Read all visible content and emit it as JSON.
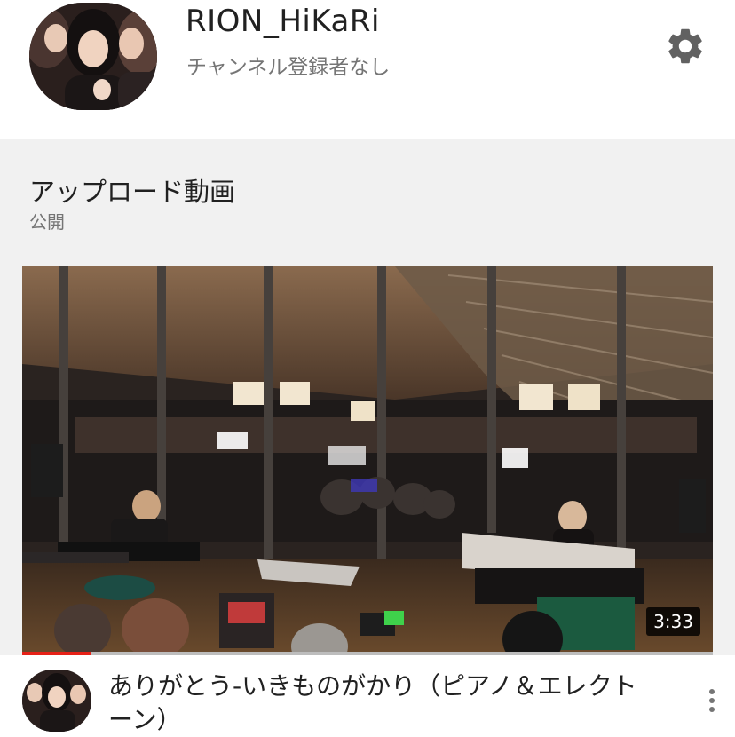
{
  "channel": {
    "name": "RION_HiKaRi",
    "subscribers": "チャンネル登録者なし"
  },
  "section": {
    "title": "アップロード動画",
    "visibility": "公開"
  },
  "video": {
    "title": "ありがとう-いきものがかり（ピアノ＆エレクトーン）",
    "duration": "3:33",
    "watched_fraction": 0.1
  },
  "icons": {
    "settings": "gear-icon",
    "more": "more-vert-icon"
  },
  "colors": {
    "progress": "#e62117",
    "section_bg": "#f1f1f1",
    "subtext": "#757575"
  }
}
